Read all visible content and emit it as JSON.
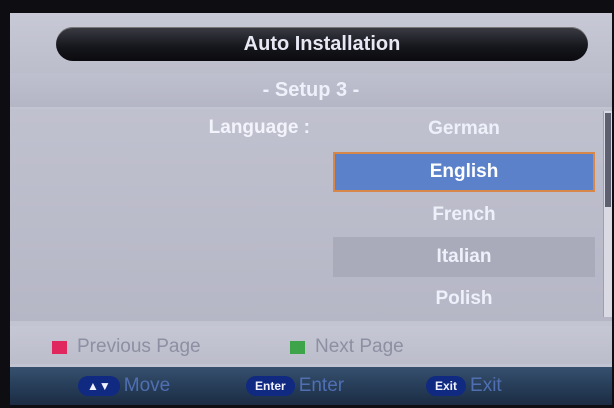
{
  "window": {
    "title": "Auto Installation",
    "subtitle": "- Setup 3 -"
  },
  "language": {
    "label": "Language :",
    "options": [
      "German",
      "English",
      "French",
      "Italian",
      "Polish"
    ],
    "selected": "English",
    "highlighted_row": "Italian"
  },
  "legend": {
    "previous": {
      "label": "Previous Page",
      "color": "#e0285f"
    },
    "next": {
      "label": "Next Page",
      "color": "#3da44a"
    }
  },
  "hints": {
    "move": {
      "key": "▲▼",
      "label": "Move"
    },
    "enter": {
      "key": "Enter",
      "label": "Enter"
    },
    "exit": {
      "key": "Exit",
      "label": "Exit"
    }
  },
  "colors": {
    "selected_bg": "#5a81c9",
    "selected_border": "#d7874a",
    "panel_bg": "#c3c4d2",
    "hint_bar": "#263c57"
  }
}
